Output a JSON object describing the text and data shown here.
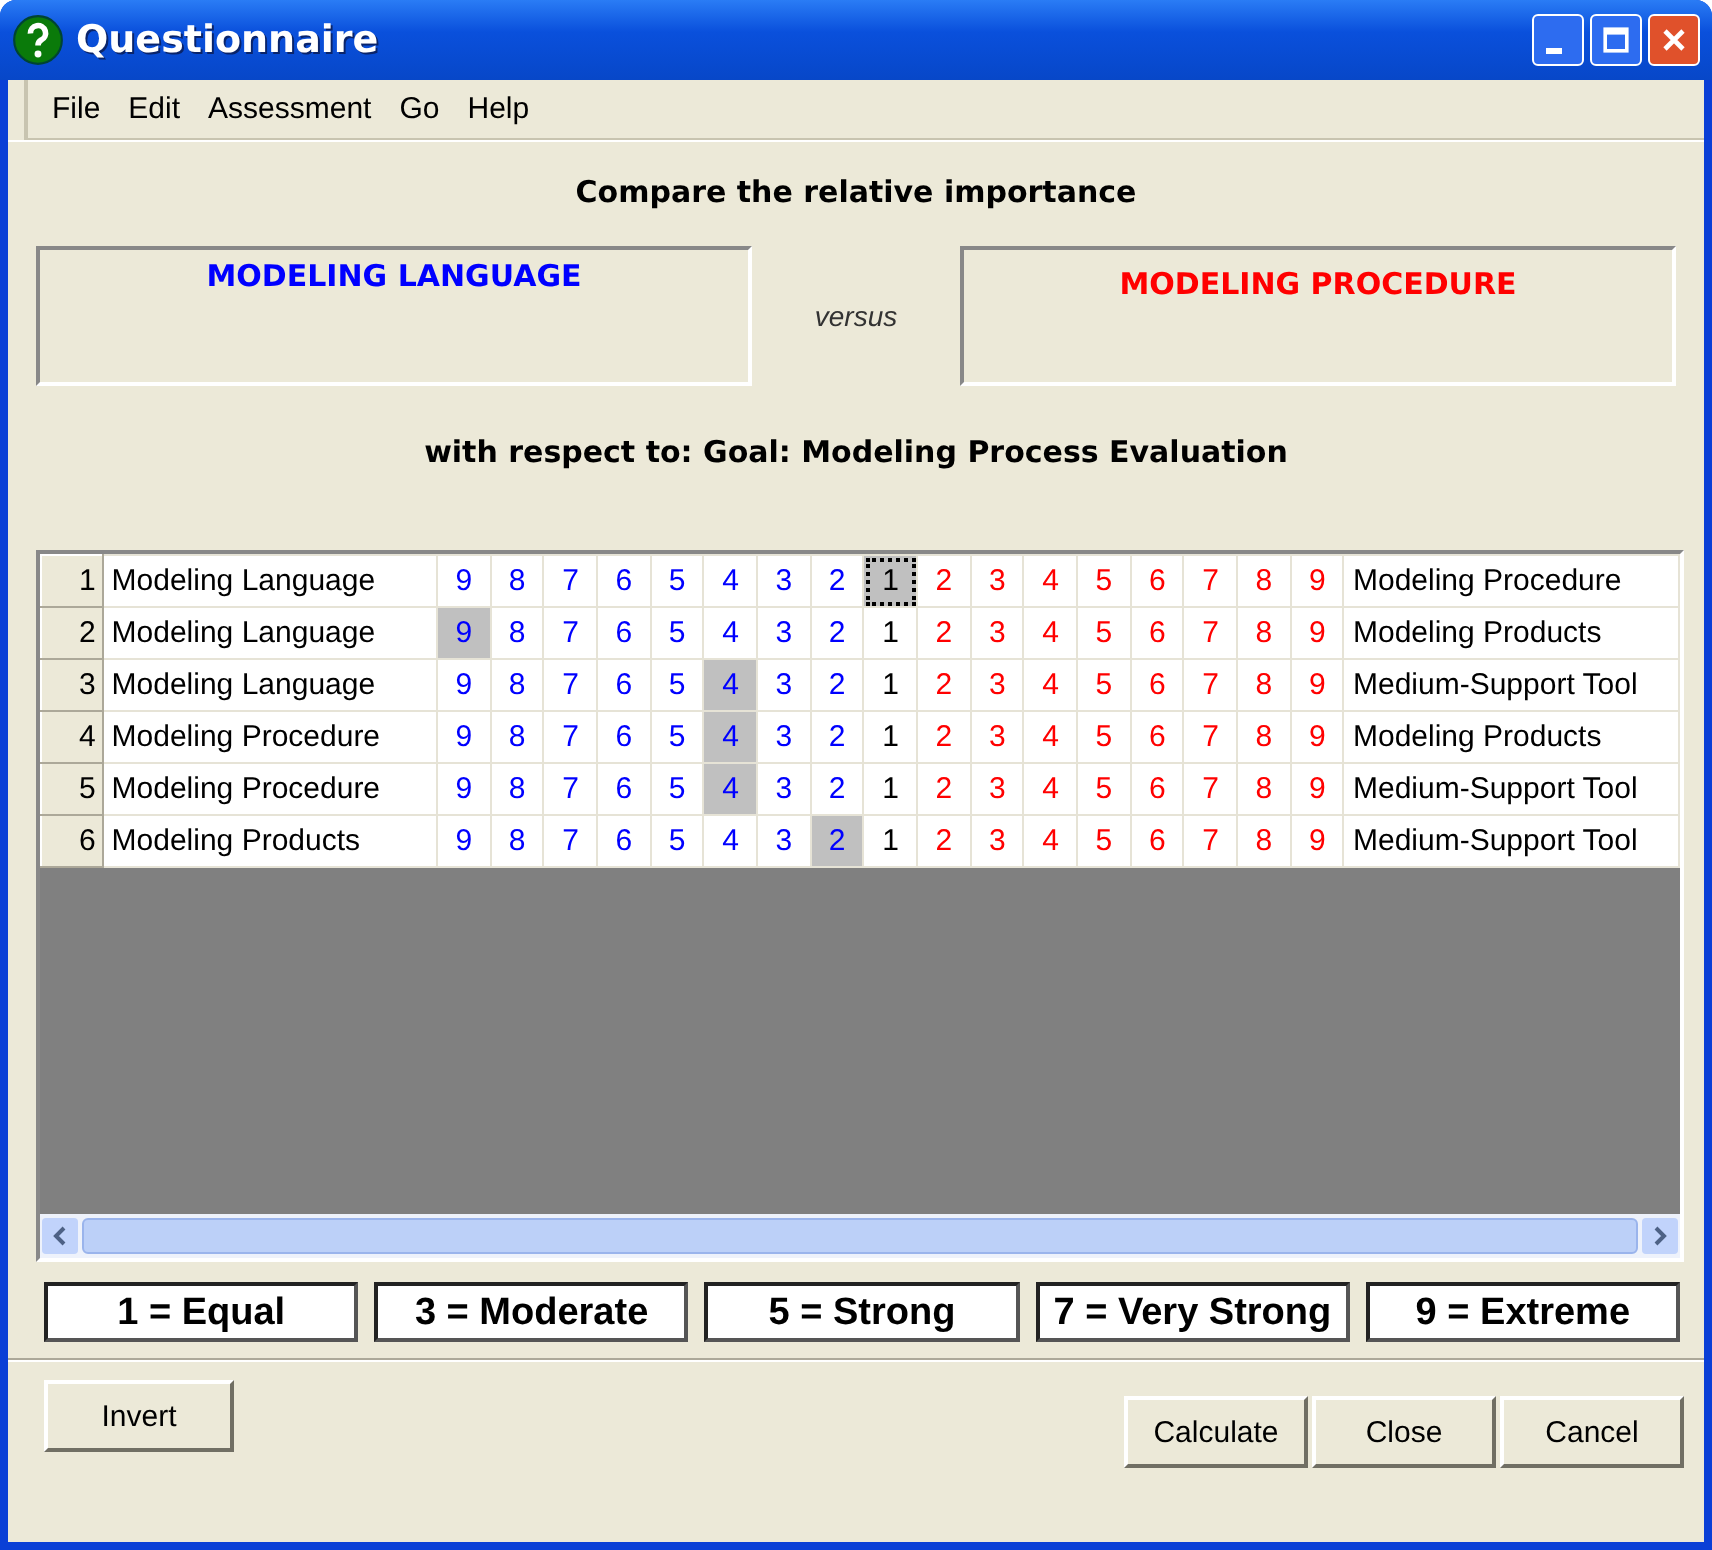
{
  "window": {
    "title": "Questionnaire"
  },
  "menu": [
    "File",
    "Edit",
    "Assessment",
    "Go",
    "Help"
  ],
  "heading": "Compare the relative importance",
  "left_box": "MODELING LANGUAGE",
  "versus": "versus",
  "right_box": "MODELING PROCEDURE",
  "respect": "with respect to: Goal: Modeling Process Evaluation",
  "rows": [
    {
      "number": "1",
      "left": "Modeling Language",
      "right": "Modeling Procedure",
      "focused": true,
      "cells": [
        {
          "v": "9",
          "kind": "left",
          "selected": false
        },
        {
          "v": "8",
          "kind": "left",
          "selected": false
        },
        {
          "v": "7",
          "kind": "left",
          "selected": false
        },
        {
          "v": "6",
          "kind": "left",
          "selected": false
        },
        {
          "v": "5",
          "kind": "left",
          "selected": false
        },
        {
          "v": "4",
          "kind": "left",
          "selected": false
        },
        {
          "v": "3",
          "kind": "left",
          "selected": false
        },
        {
          "v": "2",
          "kind": "left",
          "selected": false
        },
        {
          "v": "1",
          "kind": "equal",
          "selected": true
        },
        {
          "v": "2",
          "kind": "right",
          "selected": false
        },
        {
          "v": "3",
          "kind": "right",
          "selected": false
        },
        {
          "v": "4",
          "kind": "right",
          "selected": false
        },
        {
          "v": "5",
          "kind": "right",
          "selected": false
        },
        {
          "v": "6",
          "kind": "right",
          "selected": false
        },
        {
          "v": "7",
          "kind": "right",
          "selected": false
        },
        {
          "v": "8",
          "kind": "right",
          "selected": false
        },
        {
          "v": "9",
          "kind": "right",
          "selected": false
        }
      ]
    },
    {
      "number": "2",
      "left": "Modeling Language",
      "right": "Modeling Products",
      "focused": false,
      "cells": [
        {
          "v": "9",
          "kind": "left",
          "selected": true
        },
        {
          "v": "8",
          "kind": "left",
          "selected": false
        },
        {
          "v": "7",
          "kind": "left",
          "selected": false
        },
        {
          "v": "6",
          "kind": "left",
          "selected": false
        },
        {
          "v": "5",
          "kind": "left",
          "selected": false
        },
        {
          "v": "4",
          "kind": "left",
          "selected": false
        },
        {
          "v": "3",
          "kind": "left",
          "selected": false
        },
        {
          "v": "2",
          "kind": "left",
          "selected": false
        },
        {
          "v": "1",
          "kind": "equal",
          "selected": false
        },
        {
          "v": "2",
          "kind": "right",
          "selected": false
        },
        {
          "v": "3",
          "kind": "right",
          "selected": false
        },
        {
          "v": "4",
          "kind": "right",
          "selected": false
        },
        {
          "v": "5",
          "kind": "right",
          "selected": false
        },
        {
          "v": "6",
          "kind": "right",
          "selected": false
        },
        {
          "v": "7",
          "kind": "right",
          "selected": false
        },
        {
          "v": "8",
          "kind": "right",
          "selected": false
        },
        {
          "v": "9",
          "kind": "right",
          "selected": false
        }
      ]
    },
    {
      "number": "3",
      "left": "Modeling Language",
      "right": "Medium-Support Tool",
      "focused": false,
      "cells": [
        {
          "v": "9",
          "kind": "left",
          "selected": false
        },
        {
          "v": "8",
          "kind": "left",
          "selected": false
        },
        {
          "v": "7",
          "kind": "left",
          "selected": false
        },
        {
          "v": "6",
          "kind": "left",
          "selected": false
        },
        {
          "v": "5",
          "kind": "left",
          "selected": false
        },
        {
          "v": "4",
          "kind": "left",
          "selected": true
        },
        {
          "v": "3",
          "kind": "left",
          "selected": false
        },
        {
          "v": "2",
          "kind": "left",
          "selected": false
        },
        {
          "v": "1",
          "kind": "equal",
          "selected": false
        },
        {
          "v": "2",
          "kind": "right",
          "selected": false
        },
        {
          "v": "3",
          "kind": "right",
          "selected": false
        },
        {
          "v": "4",
          "kind": "right",
          "selected": false
        },
        {
          "v": "5",
          "kind": "right",
          "selected": false
        },
        {
          "v": "6",
          "kind": "right",
          "selected": false
        },
        {
          "v": "7",
          "kind": "right",
          "selected": false
        },
        {
          "v": "8",
          "kind": "right",
          "selected": false
        },
        {
          "v": "9",
          "kind": "right",
          "selected": false
        }
      ]
    },
    {
      "number": "4",
      "left": "Modeling Procedure",
      "right": "Modeling Products",
      "focused": false,
      "cells": [
        {
          "v": "9",
          "kind": "left",
          "selected": false
        },
        {
          "v": "8",
          "kind": "left",
          "selected": false
        },
        {
          "v": "7",
          "kind": "left",
          "selected": false
        },
        {
          "v": "6",
          "kind": "left",
          "selected": false
        },
        {
          "v": "5",
          "kind": "left",
          "selected": false
        },
        {
          "v": "4",
          "kind": "left",
          "selected": true
        },
        {
          "v": "3",
          "kind": "left",
          "selected": false
        },
        {
          "v": "2",
          "kind": "left",
          "selected": false
        },
        {
          "v": "1",
          "kind": "equal",
          "selected": false
        },
        {
          "v": "2",
          "kind": "right",
          "selected": false
        },
        {
          "v": "3",
          "kind": "right",
          "selected": false
        },
        {
          "v": "4",
          "kind": "right",
          "selected": false
        },
        {
          "v": "5",
          "kind": "right",
          "selected": false
        },
        {
          "v": "6",
          "kind": "right",
          "selected": false
        },
        {
          "v": "7",
          "kind": "right",
          "selected": false
        },
        {
          "v": "8",
          "kind": "right",
          "selected": false
        },
        {
          "v": "9",
          "kind": "right",
          "selected": false
        }
      ]
    },
    {
      "number": "5",
      "left": "Modeling Procedure",
      "right": "Medium-Support Tool",
      "focused": false,
      "cells": [
        {
          "v": "9",
          "kind": "left",
          "selected": false
        },
        {
          "v": "8",
          "kind": "left",
          "selected": false
        },
        {
          "v": "7",
          "kind": "left",
          "selected": false
        },
        {
          "v": "6",
          "kind": "left",
          "selected": false
        },
        {
          "v": "5",
          "kind": "left",
          "selected": false
        },
        {
          "v": "4",
          "kind": "left",
          "selected": true
        },
        {
          "v": "3",
          "kind": "left",
          "selected": false
        },
        {
          "v": "2",
          "kind": "left",
          "selected": false
        },
        {
          "v": "1",
          "kind": "equal",
          "selected": false
        },
        {
          "v": "2",
          "kind": "right",
          "selected": false
        },
        {
          "v": "3",
          "kind": "right",
          "selected": false
        },
        {
          "v": "4",
          "kind": "right",
          "selected": false
        },
        {
          "v": "5",
          "kind": "right",
          "selected": false
        },
        {
          "v": "6",
          "kind": "right",
          "selected": false
        },
        {
          "v": "7",
          "kind": "right",
          "selected": false
        },
        {
          "v": "8",
          "kind": "right",
          "selected": false
        },
        {
          "v": "9",
          "kind": "right",
          "selected": false
        }
      ]
    },
    {
      "number": "6",
      "left": "Modeling Products",
      "right": "Medium-Support Tool",
      "focused": false,
      "cells": [
        {
          "v": "9",
          "kind": "left",
          "selected": false
        },
        {
          "v": "8",
          "kind": "left",
          "selected": false
        },
        {
          "v": "7",
          "kind": "left",
          "selected": false
        },
        {
          "v": "6",
          "kind": "left",
          "selected": false
        },
        {
          "v": "5",
          "kind": "left",
          "selected": false
        },
        {
          "v": "4",
          "kind": "left",
          "selected": false
        },
        {
          "v": "3",
          "kind": "left",
          "selected": false
        },
        {
          "v": "2",
          "kind": "left",
          "selected": true
        },
        {
          "v": "1",
          "kind": "equal",
          "selected": false
        },
        {
          "v": "2",
          "kind": "right",
          "selected": false
        },
        {
          "v": "3",
          "kind": "right",
          "selected": false
        },
        {
          "v": "4",
          "kind": "right",
          "selected": false
        },
        {
          "v": "5",
          "kind": "right",
          "selected": false
        },
        {
          "v": "6",
          "kind": "right",
          "selected": false
        },
        {
          "v": "7",
          "kind": "right",
          "selected": false
        },
        {
          "v": "8",
          "kind": "right",
          "selected": false
        },
        {
          "v": "9",
          "kind": "right",
          "selected": false
        }
      ]
    }
  ],
  "legend": [
    "1 = Equal",
    "3 = Moderate",
    "5 = Strong",
    "7 = Very Strong",
    "9 = Extreme"
  ],
  "left_buttons": [
    "Invert"
  ],
  "right_buttons": [
    "Calculate",
    "Close",
    "Cancel"
  ]
}
